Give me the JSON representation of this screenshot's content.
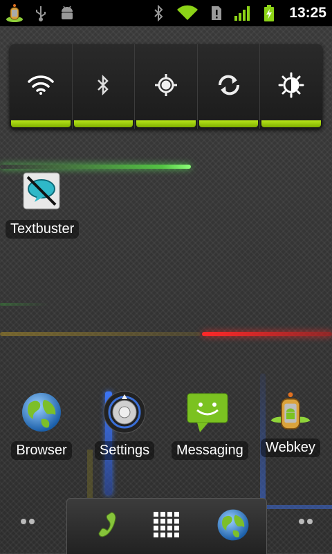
{
  "status_bar": {
    "left_icons": [
      "webkey-icon",
      "usb-icon",
      "android-debug-icon"
    ],
    "right_icons": [
      "bluetooth-icon",
      "wifi-icon",
      "sd-card-alert-icon",
      "signal-icon",
      "battery-charging-icon"
    ],
    "time": "13:25"
  },
  "power_widget": {
    "buttons": [
      {
        "name": "wifi",
        "icon": "wifi-icon",
        "state": "on"
      },
      {
        "name": "bluetooth",
        "icon": "bluetooth-icon",
        "state": "on"
      },
      {
        "name": "gps",
        "icon": "gps-icon",
        "state": "on"
      },
      {
        "name": "sync",
        "icon": "sync-icon",
        "state": "on"
      },
      {
        "name": "brightness",
        "icon": "brightness-icon",
        "state": "on"
      }
    ],
    "indicator_color": "#9acd00"
  },
  "shortcuts": {
    "textbuster": {
      "label": "Textbuster"
    },
    "browser": {
      "label": "Browser"
    },
    "settings": {
      "label": "Settings"
    },
    "messaging": {
      "label": "Messaging"
    },
    "webkey": {
      "label": "Webkey"
    }
  },
  "dock": {
    "buttons": [
      "phone-icon",
      "app-drawer-icon",
      "browser-icon"
    ]
  },
  "colors": {
    "accent": "#9acd00",
    "streak_green": "#5ae646",
    "streak_red": "#ff2828",
    "streak_blue": "#3c78ff"
  }
}
